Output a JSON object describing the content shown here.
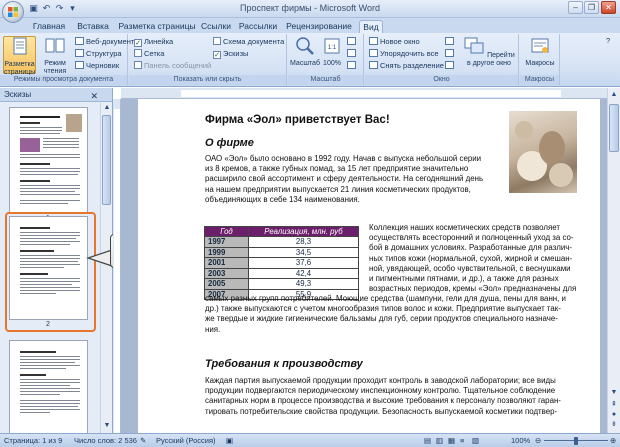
{
  "window": {
    "title": "Проспект фирмы - Microsoft Word"
  },
  "tabs": [
    "Главная",
    "Вставка",
    "Разметка страницы",
    "Ссылки",
    "Рассылки",
    "Рецензирование",
    "Вид"
  ],
  "active_tab": "Вид",
  "ribbon": {
    "view_modes": {
      "page_layout": "Разметка страницы",
      "reading": "Режим чтения",
      "web": "Веб-документ",
      "outline": "Структура",
      "draft": "Черновик",
      "label": "Режимы просмотра документа"
    },
    "show_hide": {
      "ruler": "Линейка",
      "grid": "Сетка",
      "message_bar": "Панель сообщений",
      "doc_map": "Схема документа",
      "thumbnails": "Эскизы",
      "label": "Показать или скрыть"
    },
    "zoom": {
      "zoom": "Масштаб",
      "hundred": "100%",
      "label": "Масштаб"
    },
    "window": {
      "new": "Новое окно",
      "arrange": "Упорядочить все",
      "split": "Снять разделение",
      "switch": "Перейти в другое окно",
      "label": "Окно"
    },
    "macros": {
      "macros": "Макросы",
      "label": "Макросы"
    }
  },
  "thumbnails_pane": {
    "title": "Эскизы",
    "page_numbers": [
      "1",
      "2"
    ]
  },
  "callout": "?",
  "document": {
    "title": "Фирма «Эол» приветствует Вас!",
    "heading_about": "О фирме",
    "about_lines": [
      "ОАО «Эол» было основано в 1992 году. Начав с выпуска небольшой серии",
      "из 8 кремов, а также губных помад, за 15 лет предприятие значительно",
      "расширило свой ассортимент и сферу деятельности. На сегодняшний день",
      "на нашем предприятии выпускается 21 линия косметических продуктов,",
      "объединяющих в себе 134 наименования."
    ],
    "table": {
      "headers": [
        "Год",
        "Реализация, млн. руб"
      ],
      "rows": [
        [
          "1997",
          "28,3"
        ],
        [
          "1999",
          "34,5"
        ],
        [
          "2001",
          "37,6"
        ],
        [
          "2003",
          "42,4"
        ],
        [
          "2005",
          "49,3"
        ],
        [
          "2007",
          "55,9"
        ]
      ]
    },
    "collection_right_lines": [
      "Коллекция наших косметических средств позволяет",
      "осуществлять всесторонний и полноценный уход за со-",
      "бой в домашних условиях. Разработанные для различ-",
      "ных типов кожи (нормальной, сухой, жирной и смешан-",
      "ной, увядающей, особо чувствительной, с веснушками",
      "и пигментными пятнами, и др.), а также для разных",
      "возрастных периодов, кремы «Эол» предназначены для"
    ],
    "collection_full_lines": [
      "самых разных групп потребителей. Моющие средства (шампуни, гели для душа, пены для ванн, и",
      "др.) также выпускаются с учетом многообразия типов волос и кожи. Предприятие выпускает так-",
      "же твердые и жидкие гигиенические бальзамы для губ, серии продуктов специального назначе-",
      "ния."
    ],
    "heading_requirements": "Требования к производству",
    "requirements_lines": [
      "Каждая партия выпускаемой продукции проходит контроль в заводской лаборатории; все виды",
      "продукции подвергаются периодическому инспекционному контролю. Тщательное соблюдение",
      "санитарных норм в процессе производства и высокие требования к персоналу позволяют гаран-",
      "тировать потребительские свойства продукции. Безопасность выпускаемой косметики подтвер-"
    ]
  },
  "status": {
    "page": "Страница: 1 из 9",
    "words": "Число слов: 2 536",
    "language": "Русский (Россия)",
    "zoom": "100%",
    "zoom_fraction": 0.5
  }
}
